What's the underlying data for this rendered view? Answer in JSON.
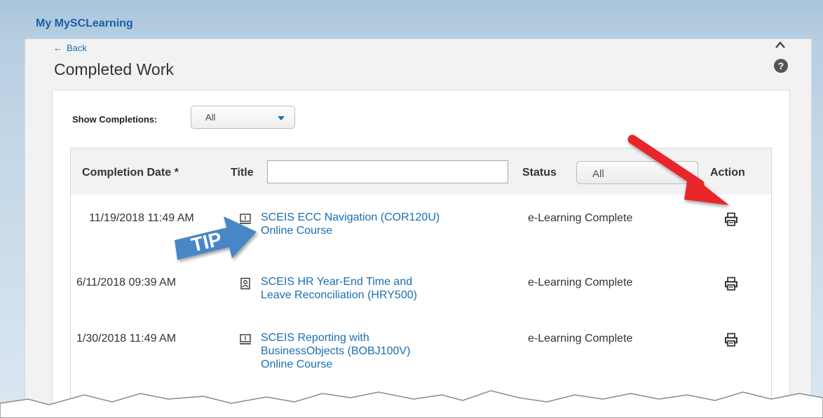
{
  "app": {
    "title": "My MySCLearning"
  },
  "nav": {
    "back_label": "Back"
  },
  "page": {
    "title": "Completed Work"
  },
  "filter": {
    "show_label": "Show Completions:",
    "show_value": "All"
  },
  "table": {
    "columns": {
      "date": "Completion Date *",
      "title": "Title",
      "status": "Status",
      "action": "Action"
    },
    "title_filter_value": "",
    "status_filter_value": "All",
    "rows": [
      {
        "date": "11/19/2018 11:49 AM",
        "title_line1": "SCEIS ECC Navigation (COR120U)",
        "title_line2": "Online Course",
        "title_line3": "",
        "status": "e-Learning Complete",
        "type_icon": "online-course-icon"
      },
      {
        "date": "6/11/2018 09:39 AM",
        "title_line1": "SCEIS HR Year-End Time and",
        "title_line2": "Leave Reconciliation (HRY500)",
        "title_line3": "",
        "status": "e-Learning Complete",
        "type_icon": "course-icon"
      },
      {
        "date": "1/30/2018 11:49 AM",
        "title_line1": "SCEIS Reporting with",
        "title_line2": "BusinessObjects (BOBJ100V)",
        "title_line3": "Online Course",
        "status": "e-Learning Complete",
        "type_icon": "online-course-icon"
      }
    ]
  },
  "annotations": {
    "tip_text": "TIP"
  },
  "colors": {
    "link": "#1a6fb2",
    "brand": "#1a5ea8",
    "tip_badge": "#4a86c5",
    "arrow": "#e8262a"
  }
}
